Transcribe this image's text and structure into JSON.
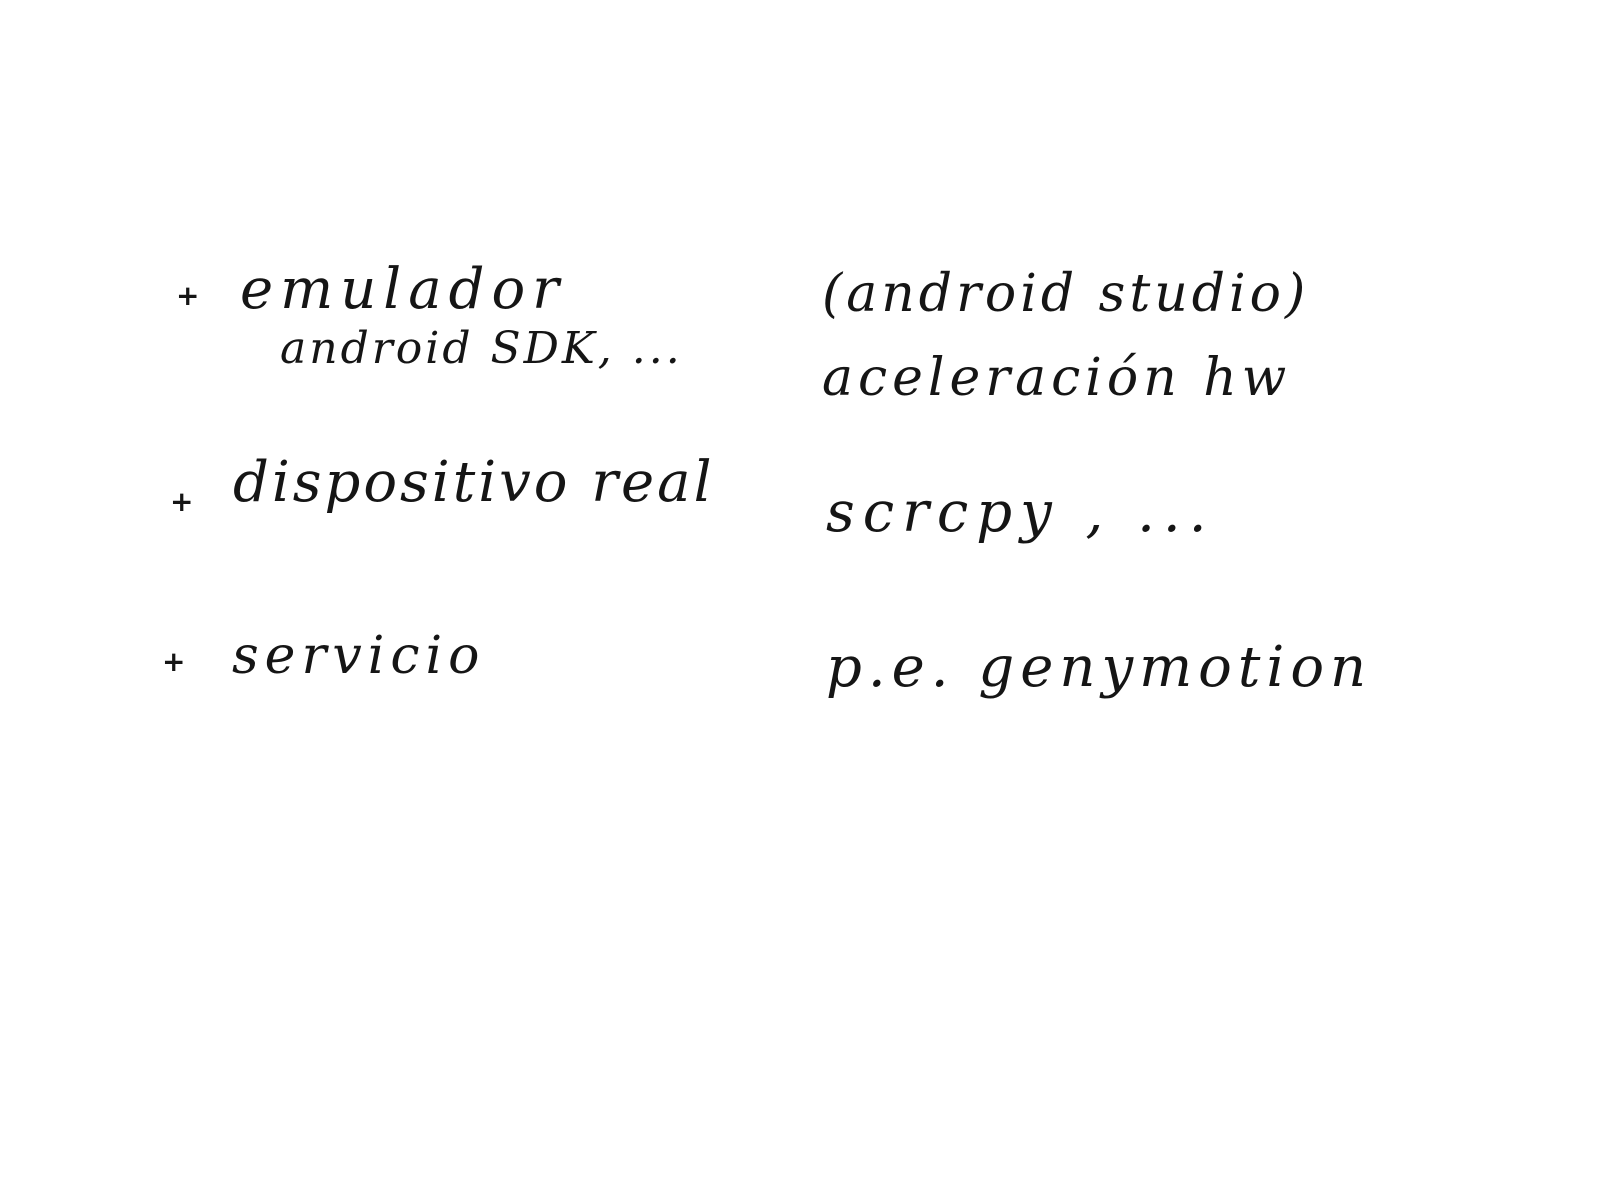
{
  "notes": {
    "left": [
      {
        "bullet": "+",
        "text": "emulador",
        "subtext": "android SDK, ..."
      },
      {
        "bullet": "+",
        "text": "dispositivo real"
      },
      {
        "bullet": "+",
        "text": "servicio"
      }
    ],
    "right": [
      "(android studio)",
      "aceleración hw",
      "scrcpy , ...",
      "p.e. genymotion"
    ]
  }
}
